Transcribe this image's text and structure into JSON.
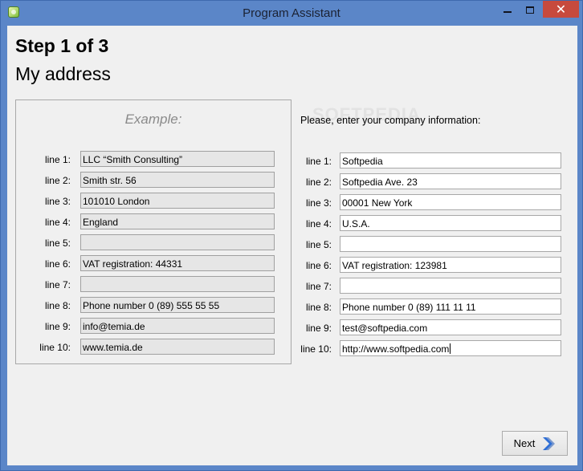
{
  "window": {
    "title": "Program Assistant",
    "close_glyph": "✕"
  },
  "header": {
    "step": "Step 1 of 3",
    "subtitle": "My address"
  },
  "example": {
    "heading": "Example:",
    "rows": [
      {
        "label": "line 1:",
        "value": "LLC “Smith Consulting”"
      },
      {
        "label": "line 2:",
        "value": "Smith str. 56"
      },
      {
        "label": "line 3:",
        "value": "101010 London"
      },
      {
        "label": "line 4:",
        "value": "England"
      },
      {
        "label": "line 5:",
        "value": ""
      },
      {
        "label": "line 6:",
        "value": "VAT registration: 44331"
      },
      {
        "label": "line 7:",
        "value": ""
      },
      {
        "label": "line 8:",
        "value": "Phone number 0 (89) 555 55 55"
      },
      {
        "label": "line 9:",
        "value": "info@temia.de"
      },
      {
        "label": "line 10:",
        "value": "www.temia.de"
      }
    ]
  },
  "form": {
    "prompt": "Please, enter your company information:",
    "rows": [
      {
        "label": "line 1:",
        "value": "Softpedia"
      },
      {
        "label": "line 2:",
        "value": "Softpedia Ave. 23"
      },
      {
        "label": "line 3:",
        "value": "00001 New York"
      },
      {
        "label": "line 4:",
        "value": "U.S.A."
      },
      {
        "label": "line 5:",
        "value": ""
      },
      {
        "label": "line 6:",
        "value": "VAT registration: 123981"
      },
      {
        "label": "line 7:",
        "value": ""
      },
      {
        "label": "line 8:",
        "value": "Phone number 0 (89) 111 11 11"
      },
      {
        "label": "line 9:",
        "value": "test@softpedia.com"
      },
      {
        "label": "line 10:",
        "value": "http://www.softpedia.com"
      }
    ]
  },
  "watermark": "SOFTPEDIA",
  "footer": {
    "next_label": "Next"
  },
  "colors": {
    "window_frame": "#5b86c8",
    "close_button": "#c74a3d",
    "next_arrow": "#2f6fd6"
  },
  "icons": {
    "app": "app-icon",
    "next": "chevron-right-icon"
  }
}
